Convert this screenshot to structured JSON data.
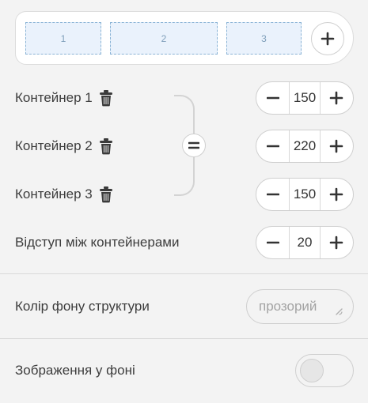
{
  "preview": {
    "boxes": [
      {
        "label": "1"
      },
      {
        "label": "2"
      },
      {
        "label": "3"
      }
    ],
    "add_icon": "plus-icon"
  },
  "containers": [
    {
      "label": "Контейнер 1",
      "value": "150"
    },
    {
      "label": "Контейнер 2",
      "value": "220"
    },
    {
      "label": "Контейнер 3",
      "value": "150"
    }
  ],
  "gap": {
    "label": "Відступ між контейнерами",
    "value": "20"
  },
  "background_color": {
    "label": "Колір фону структури",
    "value": "прозорий"
  },
  "background_image": {
    "label": "Зображення у фоні",
    "enabled": false
  },
  "icons": {
    "delete": "trash-icon",
    "equalize": "equals-icon",
    "minus": "minus-icon",
    "plus": "plus-icon"
  },
  "colors": {
    "preview_box_fill": "#eaf2fc",
    "preview_box_border": "#8bb4d6",
    "background": "#f3f3f3"
  }
}
